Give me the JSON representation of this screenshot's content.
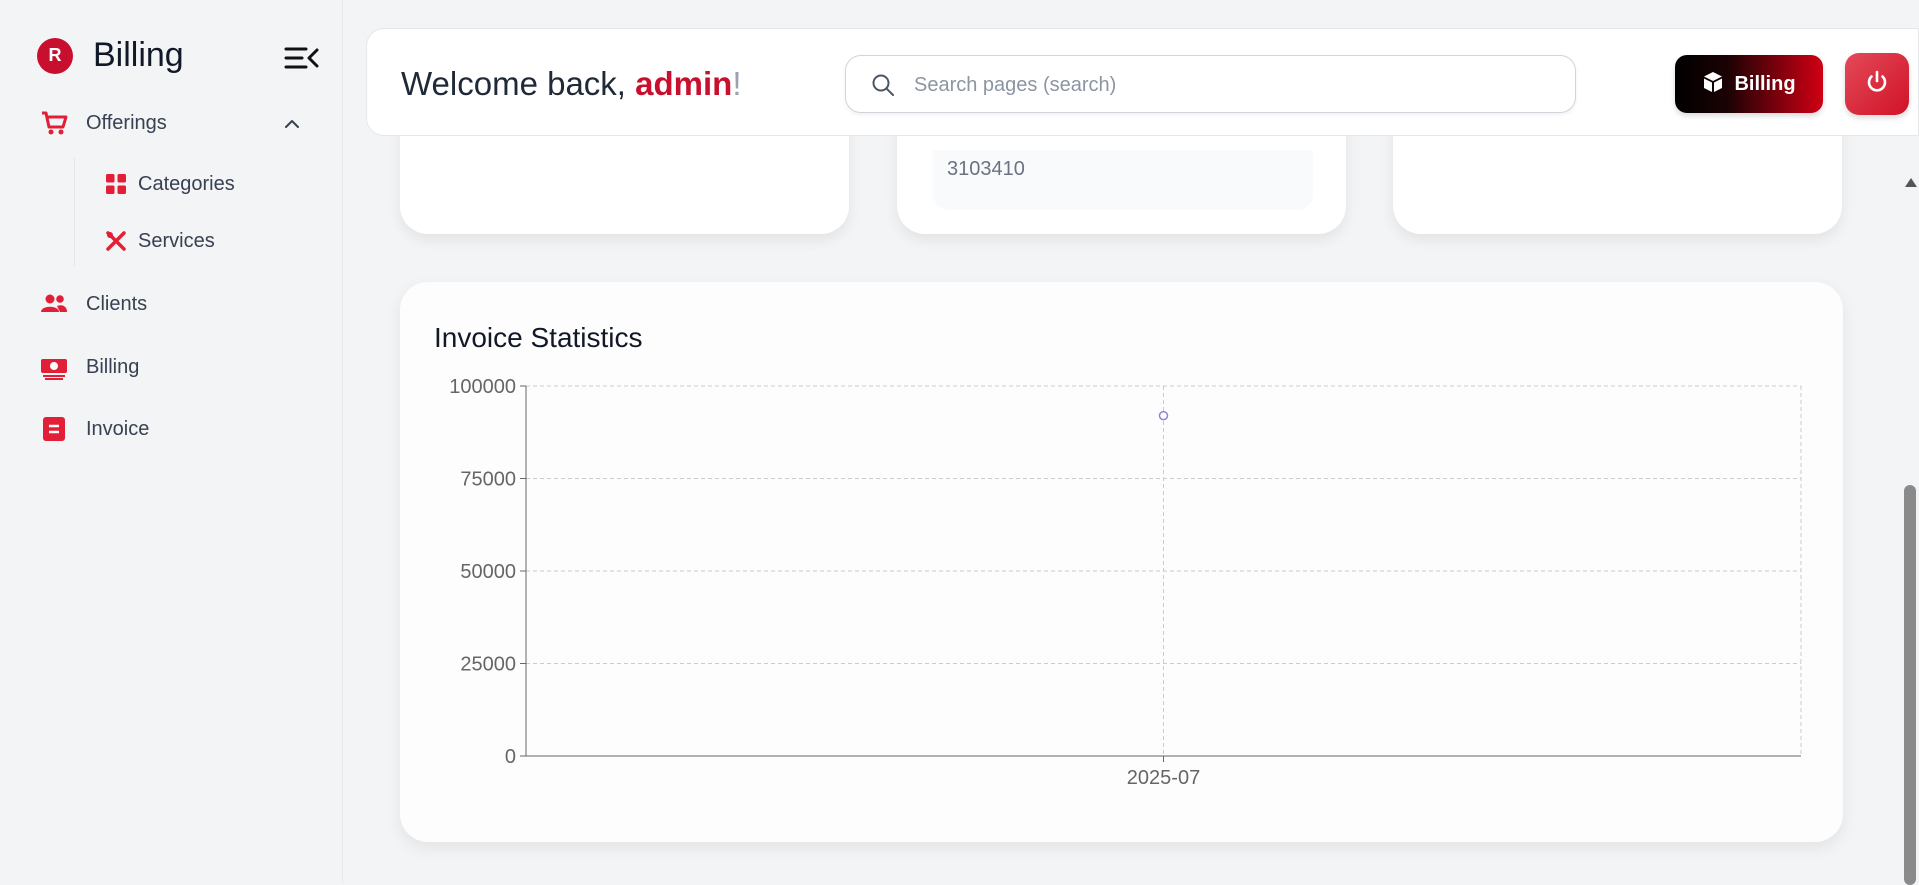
{
  "sidebar": {
    "brand_initial": "R",
    "brand_name": "Billing",
    "items": [
      {
        "label": "Offerings"
      },
      {
        "label": "Categories"
      },
      {
        "label": "Services"
      },
      {
        "label": "Clients"
      },
      {
        "label": "Billing"
      },
      {
        "label": "Invoice"
      }
    ]
  },
  "header": {
    "welcome_prefix": "Welcome back, ",
    "username": "admin",
    "welcome_suffix": "!",
    "search_placeholder": "Search pages (search)",
    "billing_button": "Billing"
  },
  "cards": {
    "partial_value": "3103410"
  },
  "colors": {
    "accent": "#c8102e",
    "point": "#8884d8"
  },
  "chart_data": {
    "type": "scatter",
    "title": "Invoice Statistics",
    "x": [
      "2025-07"
    ],
    "y": [
      92000
    ],
    "ylim": [
      0,
      100000
    ],
    "yticks": [
      0,
      25000,
      50000,
      75000,
      100000
    ],
    "grid": true
  }
}
